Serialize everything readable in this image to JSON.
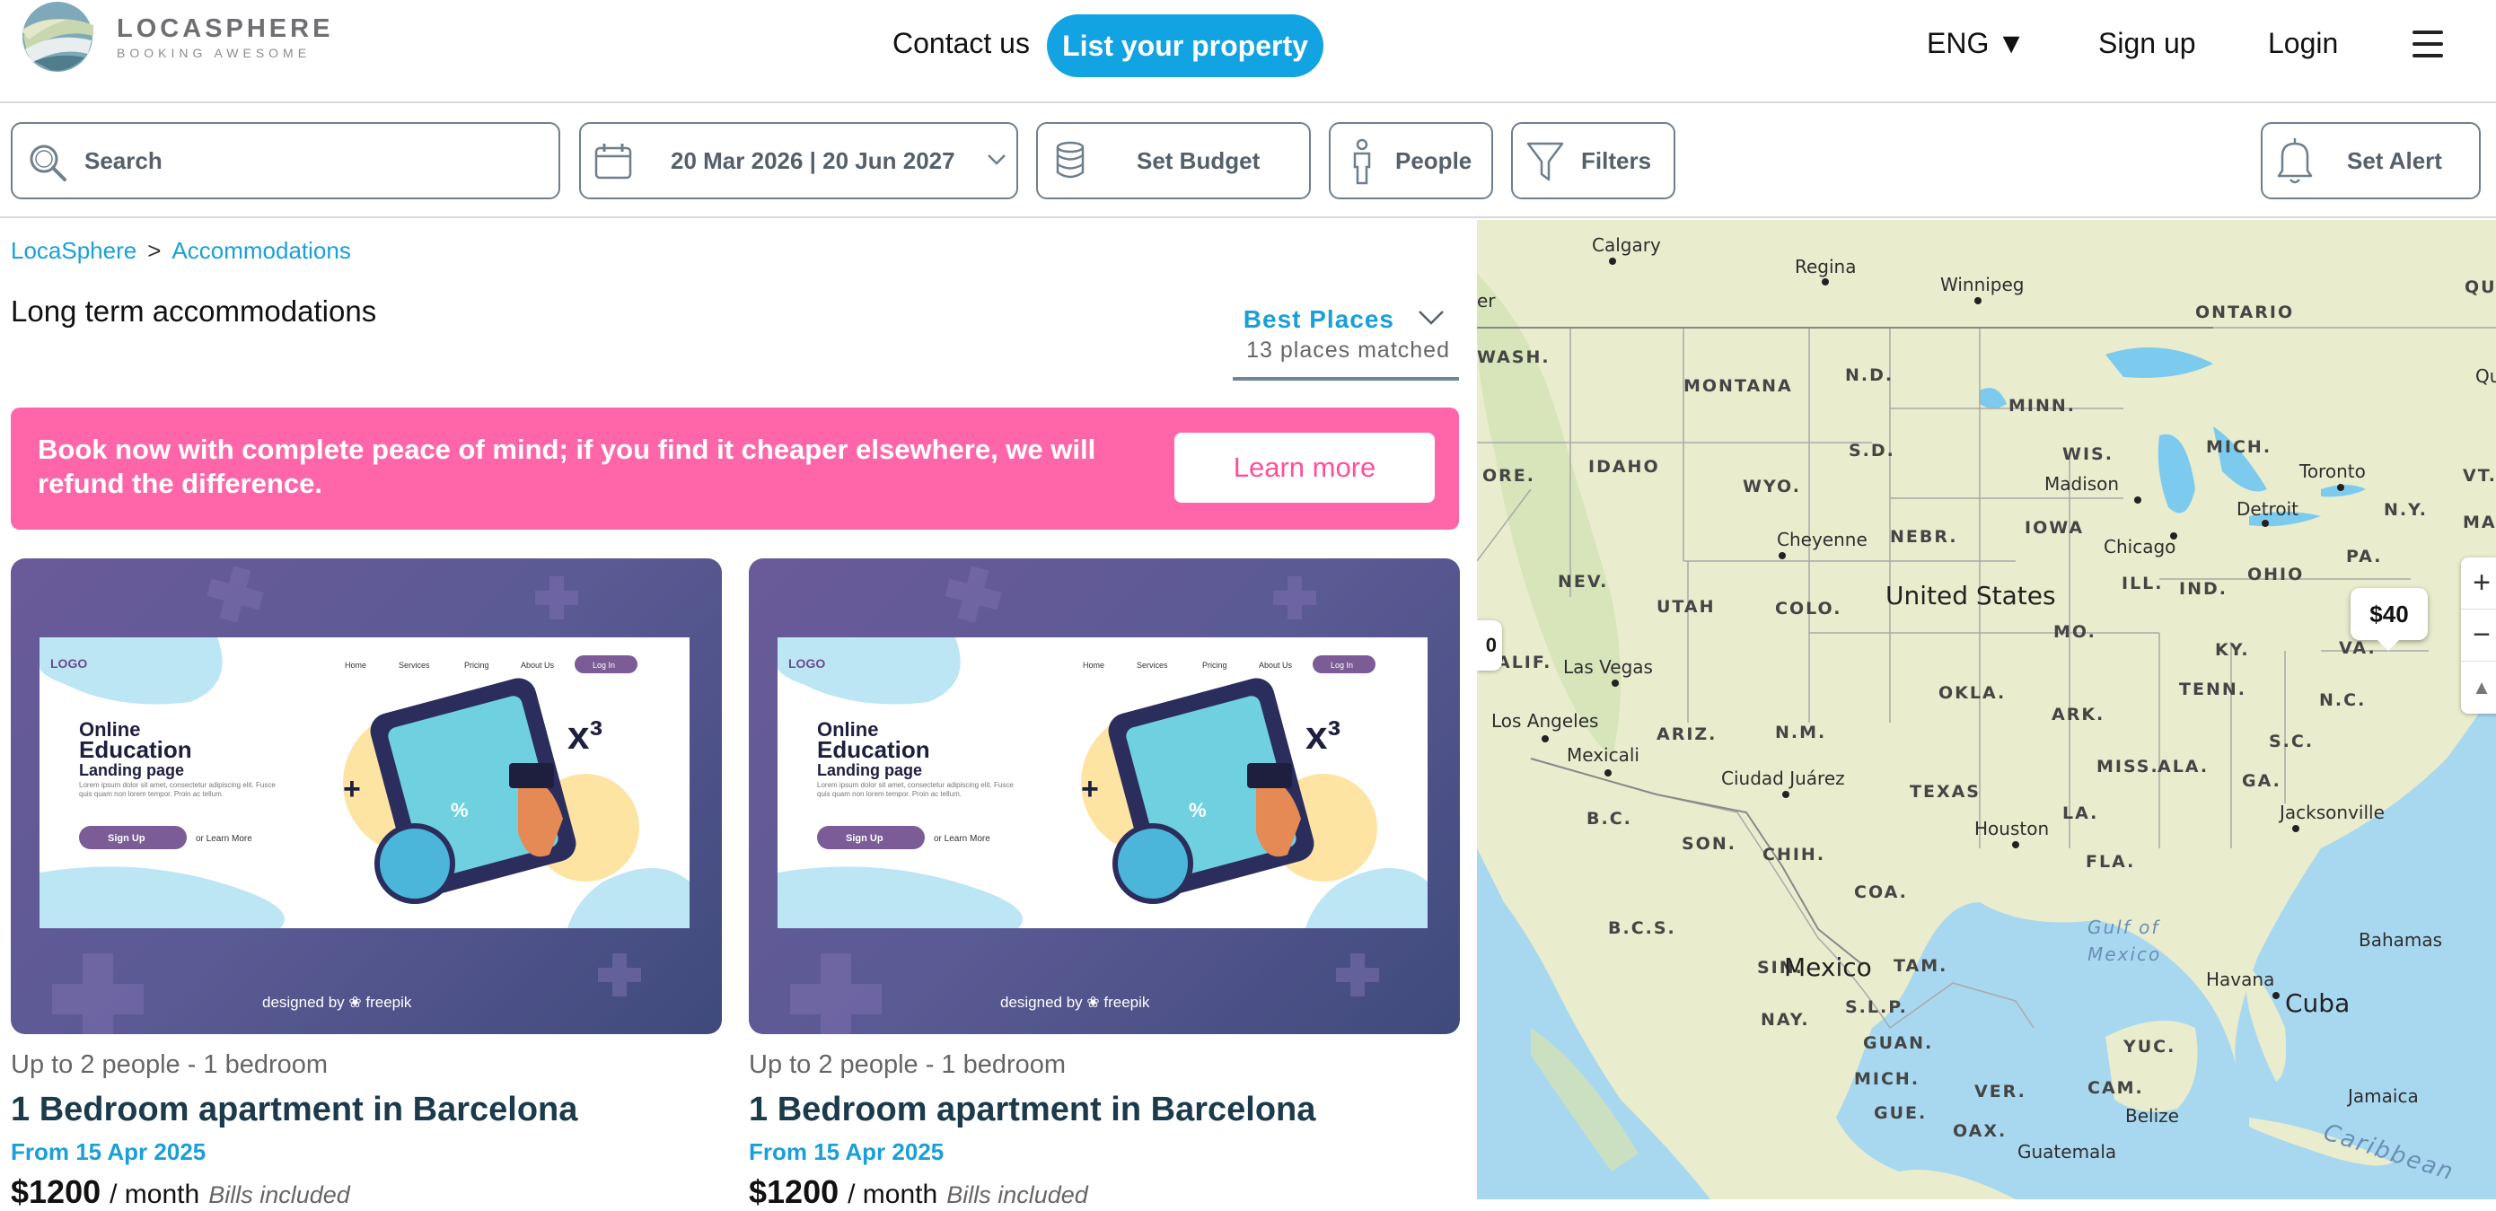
{
  "header": {
    "logo_title": "LOCASPHERE",
    "logo_subtitle": "BOOKING AWESOME",
    "contact": "Contact us",
    "list_property": "List your property",
    "language": "ENG ▼",
    "signup": "Sign up",
    "login": "Login"
  },
  "filters": {
    "search_placeholder": "Search",
    "dates": "20 Mar 2026 | 20 Jun 2027",
    "budget": "Set Budget",
    "people": "People",
    "filters": "Filters",
    "alert": "Set Alert"
  },
  "breadcrumb": [
    "LocaSphere",
    ">",
    "Accommodations"
  ],
  "page_title": "Long term accommodations",
  "sort": {
    "label": "Best Places",
    "count": "13 places matched"
  },
  "banner": {
    "text": "Book now with complete peace of mind; if you find it cheaper elsewhere, we will refund the difference.",
    "button": "Learn more"
  },
  "listing_image": {
    "logo": "LOGO",
    "nav": [
      "Home",
      "Services",
      "Pricing",
      "About Us",
      "Log In"
    ],
    "headline_1": "Online",
    "headline_2": "Education",
    "headline_3": "Landing page",
    "body": "Lorem ipsum dolor sit amet, consectetur adipiscing elit. Fusce quis quam non lorem tempor. Proin ac tellum.",
    "signup": "Sign Up",
    "learn_more": "or Learn More",
    "credit": "designed by ❀ freepik"
  },
  "listings": [
    {
      "meta": "Up to 2 people - 1 bedroom",
      "title": "1 Bedroom apartment in Barcelona",
      "from": "From 15 Apr 2025",
      "price": "$1200",
      "per": "/ month",
      "bills": "Bills included"
    },
    {
      "meta": "Up to 2 people - 1 bedroom",
      "title": "1 Bedroom apartment in Barcelona",
      "from": "From 15 Apr 2025",
      "price": "$1200",
      "per": "/ month",
      "bills": "Bills included"
    }
  ],
  "map": {
    "price_pin": "$40",
    "left_pin": "0",
    "zoom_in": "+",
    "zoom_out": "−",
    "compass": "▲",
    "labels": {
      "calgary": "Calgary",
      "regina": "Regina",
      "winnipeg": "Winnipeg",
      "ontario": "ONTARIO",
      "que": "QUÉ",
      "qu": "Qu",
      "er": "er",
      "wash": "WASH.",
      "montana": "MONTANA",
      "nd": "N.D.",
      "minn": "MINN.",
      "ore": "ORE.",
      "idaho": "IDAHO",
      "sd": "S.D.",
      "wis": "WIS.",
      "mich": "MICH.",
      "toronto": "Toronto",
      "vt": "VT.",
      "madison": "Madison",
      "wyo": "WYO.",
      "detroit": "Detroit",
      "ny": "N.Y.",
      "mas": "MAS",
      "iowa": "IOWA",
      "cheyenne": "Cheyenne",
      "nebr": "NEBR.",
      "chicago": "Chicago",
      "pa": "PA.",
      "ohio": "OHIO",
      "nev": "NEV.",
      "utah": "UTAH",
      "colo": "COLO.",
      "usa": "United States",
      "ill": "ILL.",
      "ind": "IND.",
      "alif": "ALIF.",
      "lasvegas": "Las Vegas",
      "mo": "MO.",
      "va": "VA.",
      "ky": "KY.",
      "okla": "OKLA.",
      "tenn": "TENN.",
      "nc": "N.C.",
      "losangeles": "Los Angeles",
      "ariz": "ARIZ.",
      "nm": "N.M.",
      "ark": "ARK.",
      "sc": "S.C.",
      "mexicali": "Mexicali",
      "ciudadjuarez": "Ciudad Juárez",
      "texas": "TEXAS",
      "miss": "MISS.",
      "ala": "ALA.",
      "ga": "GA.",
      "bc": "B.C.",
      "houston": "Houston",
      "jacksonville": "Jacksonville",
      "la": "LA.",
      "son": "SON.",
      "chih": "CHIH.",
      "coa": "COA.",
      "fla": "FLA.",
      "gulf1": "Gulf of",
      "gulf2": "Mexico",
      "bcs": "B.C.S.",
      "bahamas": "Bahamas",
      "sin": "SIN.",
      "mexico": "Mexico",
      "tam": "TAM.",
      "havana": "Havana",
      "cuba": "Cuba",
      "nay": "NAY.",
      "slp": "S.L.P.",
      "guan": "GUAN.",
      "yuc": "YUC.",
      "michm": "MICH.",
      "ver": "VER.",
      "cam": "CAM.",
      "belize": "Belize",
      "jamaica": "Jamaica",
      "gue": "GUE.",
      "oax": "OAX.",
      "guatemala": "Guatemala",
      "caribbean": "Caribbean"
    }
  }
}
